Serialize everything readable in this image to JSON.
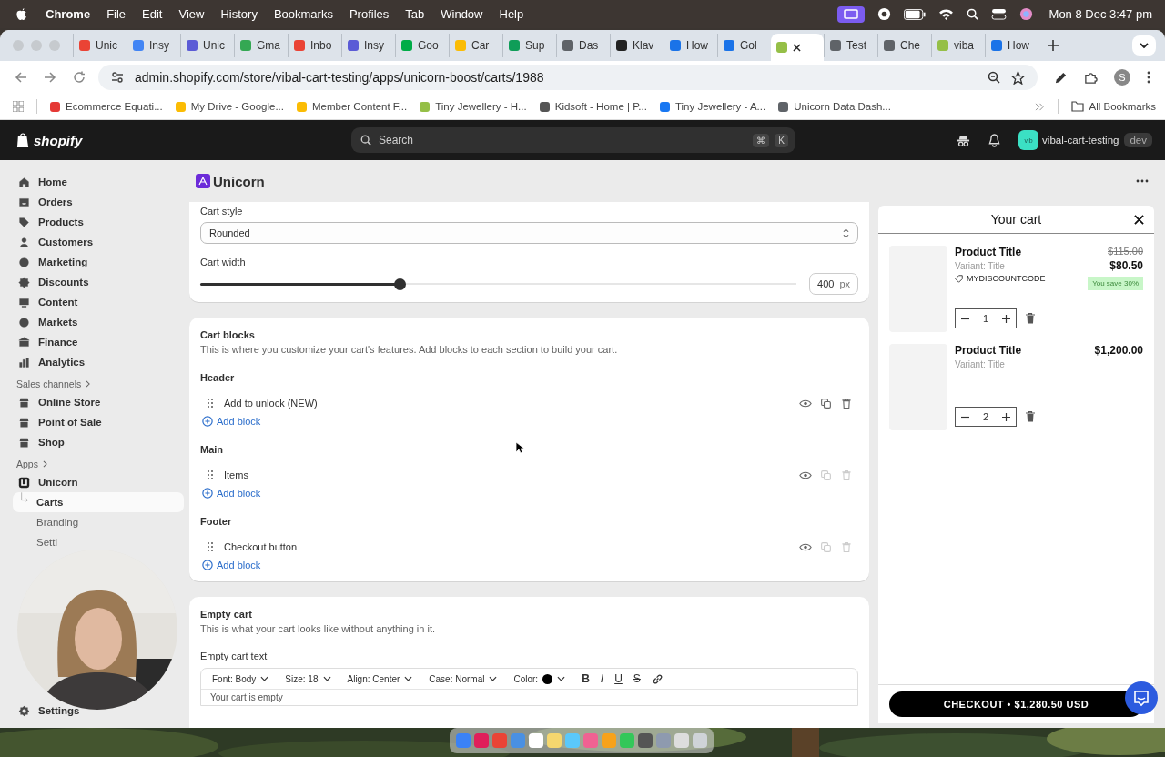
{
  "menu_bar": {
    "app": "Chrome",
    "items": [
      "File",
      "Edit",
      "View",
      "History",
      "Bookmarks",
      "Profiles",
      "Tab",
      "Window",
      "Help"
    ],
    "clock": "Mon 8 Dec  3:47 pm"
  },
  "tabs": [
    {
      "label": "Unic",
      "color": "#ea4335",
      "selected": false
    },
    {
      "label": "Insy",
      "color": "#4285f4",
      "selected": false
    },
    {
      "label": "Unic",
      "color": "#5b5bd6",
      "selected": false
    },
    {
      "label": "Gma",
      "color": "#34a853",
      "selected": false
    },
    {
      "label": "Inbo",
      "color": "#ea4335",
      "selected": false
    },
    {
      "label": "Insy",
      "color": "#5b5bd6",
      "selected": false
    },
    {
      "label": "Goo",
      "color": "#00ac47",
      "selected": false
    },
    {
      "label": "Car",
      "color": "#fbbc04",
      "selected": false
    },
    {
      "label": "Sup",
      "color": "#0f9d58",
      "selected": false
    },
    {
      "label": "Das",
      "color": "#5f6368",
      "selected": false
    },
    {
      "label": "Klav",
      "color": "#222222",
      "selected": false
    },
    {
      "label": "How",
      "color": "#1a73e8",
      "selected": false
    },
    {
      "label": "Gol",
      "color": "#1a73e8",
      "selected": false
    },
    {
      "color": "#95bf47",
      "selected": true
    },
    {
      "label": "Test",
      "color": "#5f6368",
      "selected": false
    },
    {
      "label": "Che",
      "color": "#5f6368",
      "selected": false
    },
    {
      "label": "viba",
      "color": "#95bf47",
      "selected": false
    },
    {
      "label": "How",
      "color": "#1a73e8",
      "selected": false
    }
  ],
  "address_bar": {
    "url": "admin.shopify.com/store/vibal-cart-testing/apps/unicorn-boost/carts/1988",
    "profile": "S"
  },
  "bookmarks": [
    {
      "label": "Ecommerce Equati...",
      "color": "#e53935"
    },
    {
      "label": "My Drive - Google...",
      "color": "#fbbc04"
    },
    {
      "label": "Member Content F...",
      "color": "#fbbc04"
    },
    {
      "label": "Tiny Jewellery - H...",
      "color": "#95bf47"
    },
    {
      "label": "Kidsoft - Home | P...",
      "color": "#555555"
    },
    {
      "label": "Tiny Jewellery - A...",
      "color": "#1877f2"
    },
    {
      "label": "Unicorn Data Dash...",
      "color": "#5f6368"
    }
  ],
  "all_bookmarks": "All Bookmarks",
  "topbar": {
    "logo": "shopify",
    "search_placeholder": "Search",
    "shortcut": [
      "⌘",
      "K"
    ],
    "store_avatar": "vib",
    "store": "vibal-cart-testing",
    "badge": "dev"
  },
  "sidebar": {
    "nav": [
      {
        "label": "Home",
        "selected": false
      },
      {
        "label": "Orders",
        "selected": false
      },
      {
        "label": "Products",
        "selected": false
      },
      {
        "label": "Customers",
        "selected": false
      },
      {
        "label": "Marketing",
        "selected": false
      },
      {
        "label": "Discounts",
        "selected": false
      },
      {
        "label": "Content",
        "selected": false
      },
      {
        "label": "Markets",
        "selected": false
      },
      {
        "label": "Finance",
        "selected": false
      },
      {
        "label": "Analytics",
        "selected": false
      }
    ],
    "channels_heading": "Sales channels",
    "channels": [
      {
        "label": "Online Store"
      },
      {
        "label": "Point of Sale"
      },
      {
        "label": "Shop"
      }
    ],
    "apps_heading": "Apps",
    "app": "Unicorn",
    "app_pages": [
      {
        "label": "Carts",
        "selected": true
      },
      {
        "label": "Branding",
        "selected": false
      },
      {
        "label": "Setti",
        "selected": false
      }
    ],
    "settings": "Settings"
  },
  "page": {
    "title": "Unicorn"
  },
  "style_card": {
    "style_label": "Cart style",
    "style_value": "Rounded",
    "width_label": "Cart width",
    "width": {
      "level": 0.336,
      "value": "400",
      "unit": "px"
    }
  },
  "blocks_card": {
    "title": "Cart blocks",
    "description": "This is where you customize your cart's features. Add blocks to each section to build your cart.",
    "sections": [
      {
        "title": "Header",
        "blocks": [
          {
            "label": "Add to unlock (NEW)",
            "locked": false
          }
        ],
        "add_label": "Add block"
      },
      {
        "title": "Main",
        "blocks": [
          {
            "label": "Items",
            "locked": true
          }
        ],
        "add_label": "Add block"
      },
      {
        "title": "Footer",
        "blocks": [
          {
            "label": "Checkout button",
            "locked": true
          }
        ],
        "add_label": "Add block"
      }
    ]
  },
  "empty_card": {
    "title": "Empty cart",
    "description": "This is what your cart looks like without anything in it.",
    "field_label": "Empty cart text",
    "toolbar": {
      "dropdowns": [
        "Font: Body",
        "Size: 18",
        "Align: Center",
        "Case: Normal"
      ],
      "color_label": "Color:",
      "formats": [
        "B",
        "I",
        "U",
        "S"
      ]
    },
    "text": "Your cart is empty"
  },
  "cart": {
    "title": "Your cart",
    "items": [
      {
        "title": "Product Title",
        "variant": "Variant:  Title",
        "discount": "MYDISCOUNTCODE",
        "compare_price": "$115.00",
        "price": "$80.50",
        "savings": "You save 30%",
        "qty": "1"
      },
      {
        "title": "Product Title",
        "variant": "Variant:  Title",
        "price": "$1,200.00",
        "qty": "2"
      }
    ],
    "checkout": "CHECKOUT • $1,280.50 USD"
  },
  "dock": [
    {
      "color": "#3b82f6"
    },
    {
      "color": "#e01e5a"
    },
    {
      "color": "#ea4335"
    },
    {
      "color": "#4a90e2"
    },
    {
      "color": "#ffffff"
    },
    {
      "color": "#f5d76e"
    },
    {
      "color": "#5ac8fa"
    },
    {
      "color": "#f06292"
    },
    {
      "color": "#f7a21b"
    },
    {
      "color": "#34c759"
    },
    {
      "color": "#555555"
    },
    {
      "color": "#8e9aaf"
    },
    {
      "color": "#dddddd"
    },
    {
      "color": "#cfd3d8"
    }
  ]
}
